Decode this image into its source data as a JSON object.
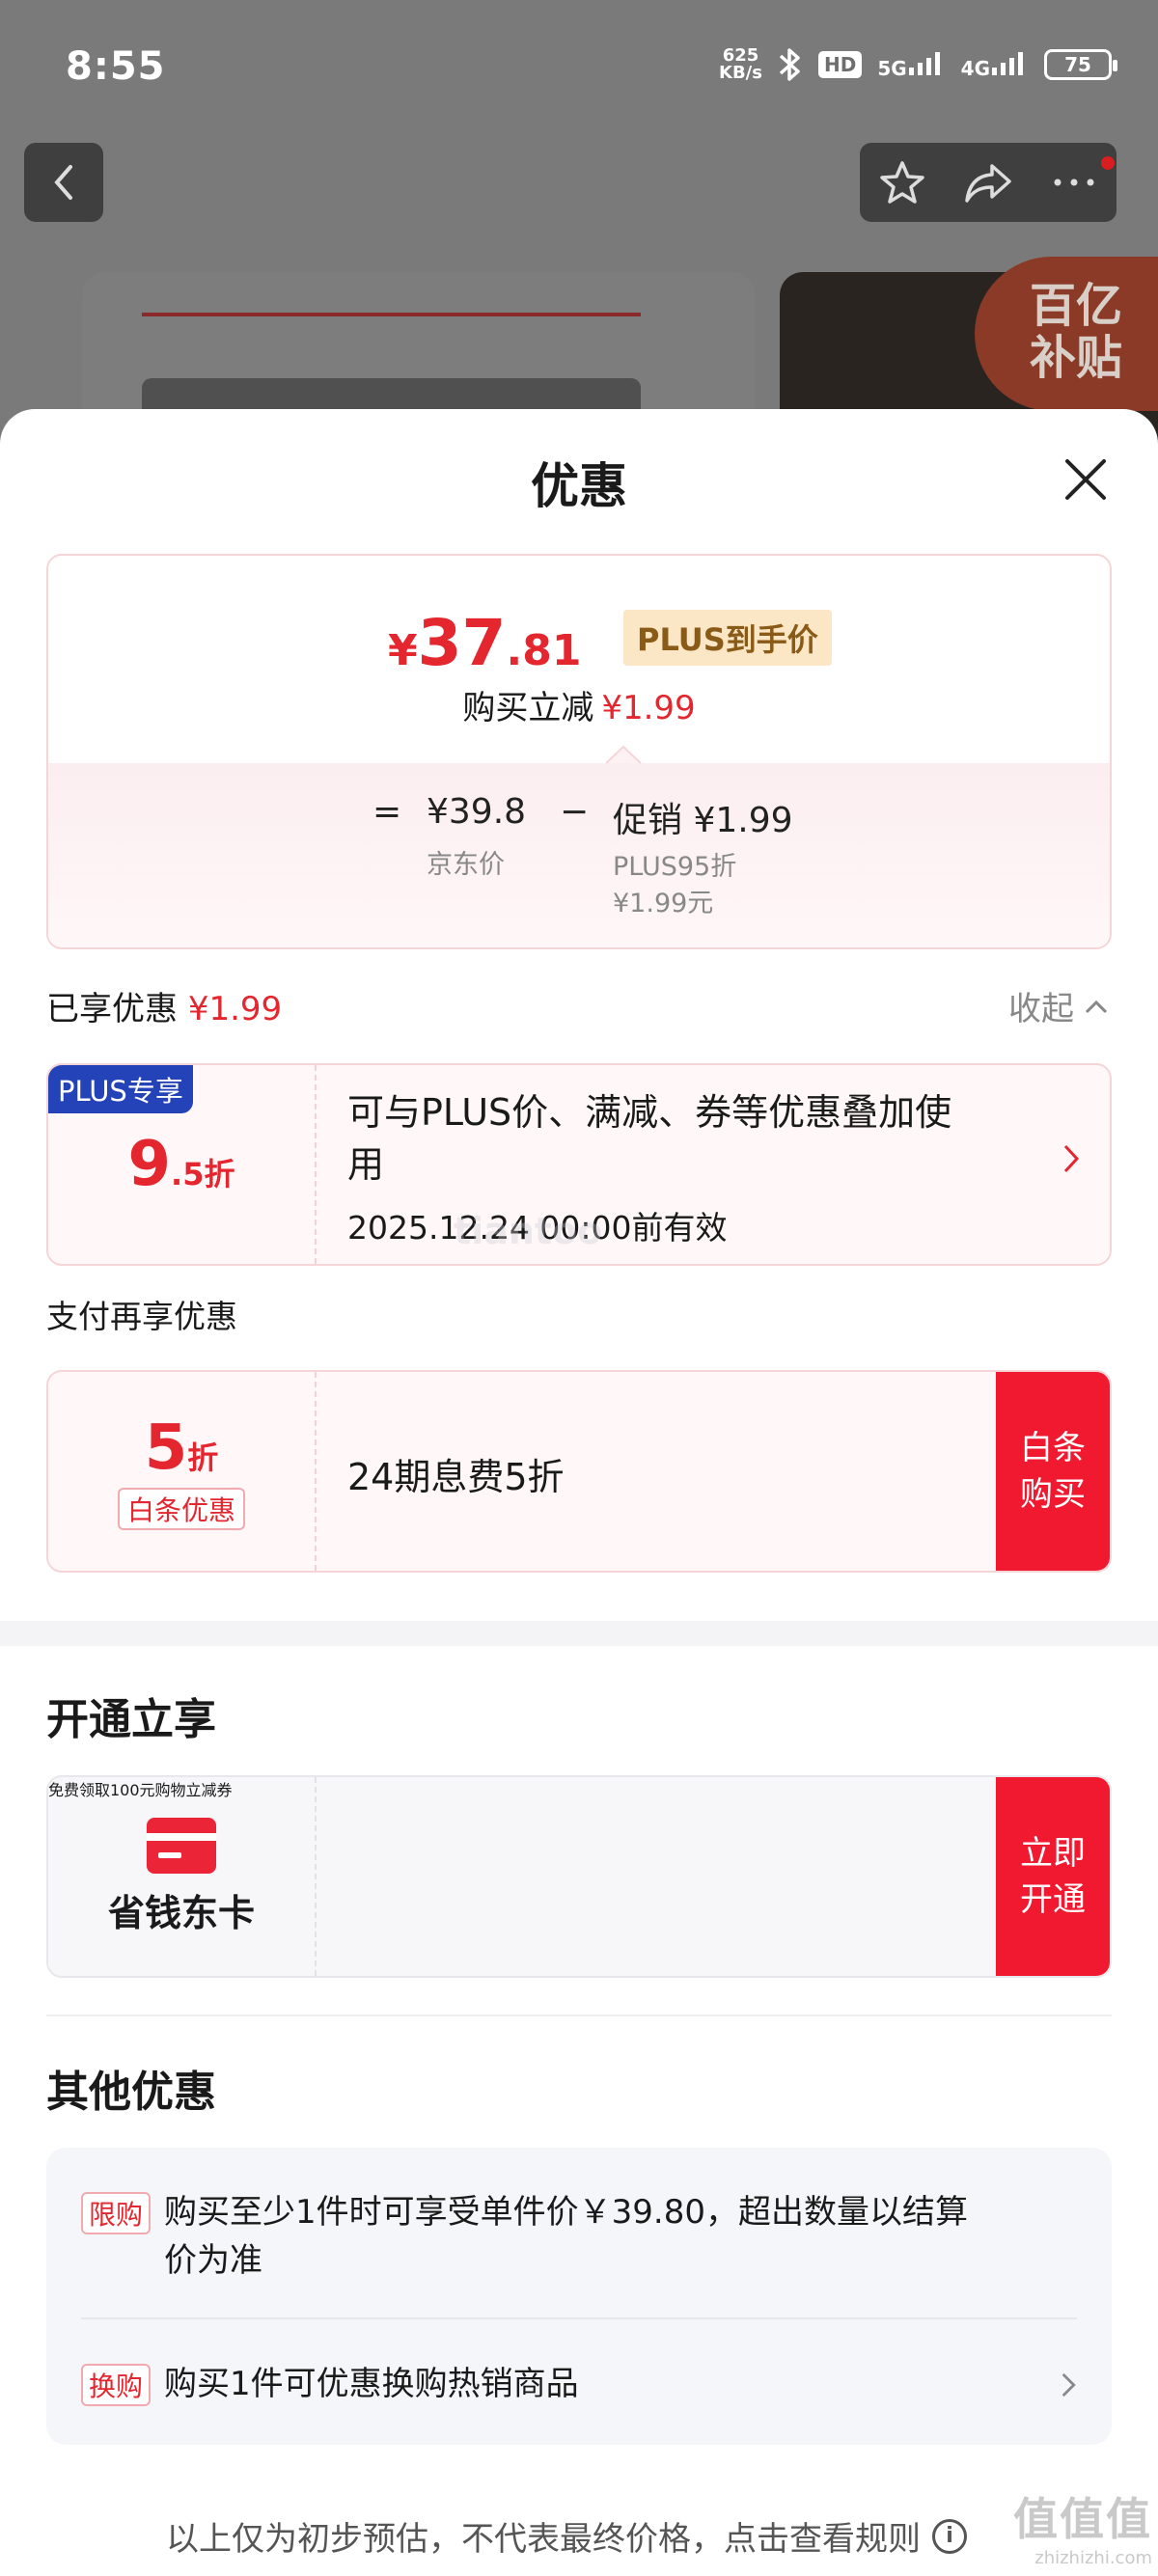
{
  "status_bar": {
    "time": "8:55",
    "net_speed_value": "625",
    "net_speed_unit": "KB/s",
    "hd": "HD",
    "signal_1": "5G",
    "signal_2": "4G",
    "battery": "75"
  },
  "background_page": {
    "badge_line1": "百亿",
    "badge_line2": "补贴"
  },
  "sheet": {
    "title": "优惠",
    "price_card": {
      "currency": "¥",
      "price_int": "37",
      "price_dec": ".81",
      "plus_tag": "PLUS到手价",
      "reduce_label": "购买立减",
      "reduce_value": "¥1.99",
      "equals": "=",
      "jd_price_value": "¥39.8",
      "jd_price_label": "京东价",
      "minus": "−",
      "promo_value": "促销 ¥1.99",
      "promo_detail_1": "PLUS95折",
      "promo_detail_2": "¥1.99元"
    },
    "enjoyed": {
      "label": "已享优惠",
      "value": "¥1.99",
      "collapse": "收起"
    },
    "plus_coupon": {
      "badge": "PLUS专享",
      "disc_big": "9",
      "disc_small": ".5折",
      "line1": "可与PLUS价、满减、券等优惠叠加使",
      "line2": "用",
      "validity": "2025.12.24 00:00前有效"
    },
    "pay_section": {
      "title": "支付再享优惠",
      "disc_big": "5",
      "disc_small": "折",
      "tag": "白条优惠",
      "text": "24期息费5折",
      "button_line1": "白条",
      "button_line2": "购买"
    },
    "open_section": {
      "title": "开通立享",
      "card_name": "省钱东卡",
      "text": "免费领取100元购物立减券",
      "button_line1": "立即",
      "button_line2": "开通"
    },
    "other_section": {
      "title": "其他优惠",
      "items": [
        {
          "tag": "限购",
          "line1": "购买至少1件时可享受单件价￥39.80，超出数量以结算",
          "line2": "价为准"
        },
        {
          "tag": "换购",
          "line1": "购买1件可优惠换购热销商品",
          "line2": ""
        }
      ]
    },
    "footer": {
      "note": "以上仅为初步预估，不代表最终价格，点击查看规则",
      "info_icon": "i"
    }
  },
  "watermark": {
    "center": "tiantoo",
    "corner_big": "值值值",
    "corner_small": "zhizhizhi.com"
  },
  "colors": {
    "accent_red": "#e4262f",
    "button_red": "#f0192f",
    "plus_blue": "#2443b8",
    "plus_gold_bg": "#fbe7c6"
  }
}
